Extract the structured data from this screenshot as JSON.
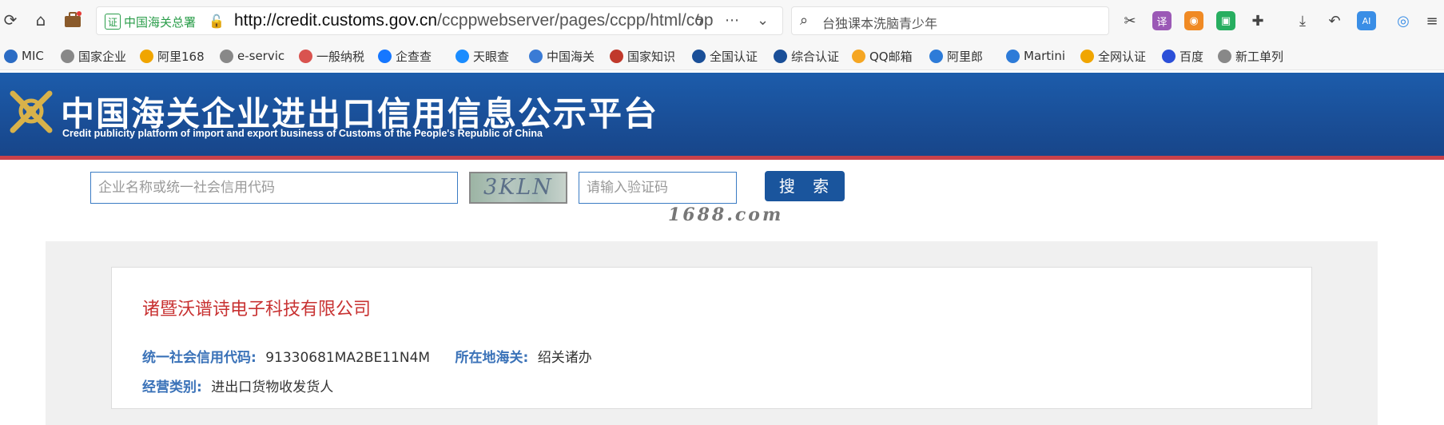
{
  "browser": {
    "site_badge_icon": "证",
    "site_badge_text": "中国海关总署",
    "url_domain": "http://credit.customs.gov.cn",
    "url_path": "/ccppwebserver/pages/ccpp/html/copl",
    "search_text": "台独课本洗脑青少年",
    "ext_translate": "译",
    "ext_ai": "AI"
  },
  "bookmarks": [
    {
      "label": "MIC",
      "color": "#2b6cc4"
    },
    {
      "label": "国家企业",
      "color": "#888"
    },
    {
      "label": "阿里168",
      "color": "#f0a500"
    },
    {
      "label": "e-servic",
      "color": "#888"
    },
    {
      "label": "一般纳税",
      "color": "#d9534f"
    },
    {
      "label": "企查查",
      "color": "#1677ff"
    },
    {
      "label": "天眼查",
      "color": "#1a8cff"
    },
    {
      "label": "中国海关",
      "color": "#3a7bd5"
    },
    {
      "label": "国家知识",
      "color": "#c0392b"
    },
    {
      "label": "全国认证",
      "color": "#1a4f98"
    },
    {
      "label": "综合认证",
      "color": "#1a4f98"
    },
    {
      "label": "QQ邮箱",
      "color": "#f5a623"
    },
    {
      "label": "阿里郎",
      "color": "#2d7bd8"
    },
    {
      "label": "Martini",
      "color": "#2d7bd8"
    },
    {
      "label": "全网认证",
      "color": "#f0a500"
    },
    {
      "label": "百度",
      "color": "#2b4fd8"
    },
    {
      "label": "新工单列",
      "color": "#888"
    }
  ],
  "header": {
    "title": "中国海关企业进出口信用信息公示平台",
    "subtitle": "Credit publicity platform of import and export business of Customs of the People's Republic of China"
  },
  "search": {
    "company_placeholder": "企业名称或统一社会信用代码",
    "captcha_text": "3KLN",
    "captcha_placeholder": "请输入验证码",
    "button_label": "搜 索"
  },
  "watermark": "1688.com",
  "result": {
    "company_name": "诸暨沃谱诗电子科技有限公司",
    "credit_code_label": "统一社会信用代码:",
    "credit_code_value": "91330681MA2BE11N4M",
    "customs_label": "所在地海关:",
    "customs_value": "绍关诸办",
    "business_type_label": "经营类别:",
    "business_type_value": "进出口货物收发货人"
  }
}
